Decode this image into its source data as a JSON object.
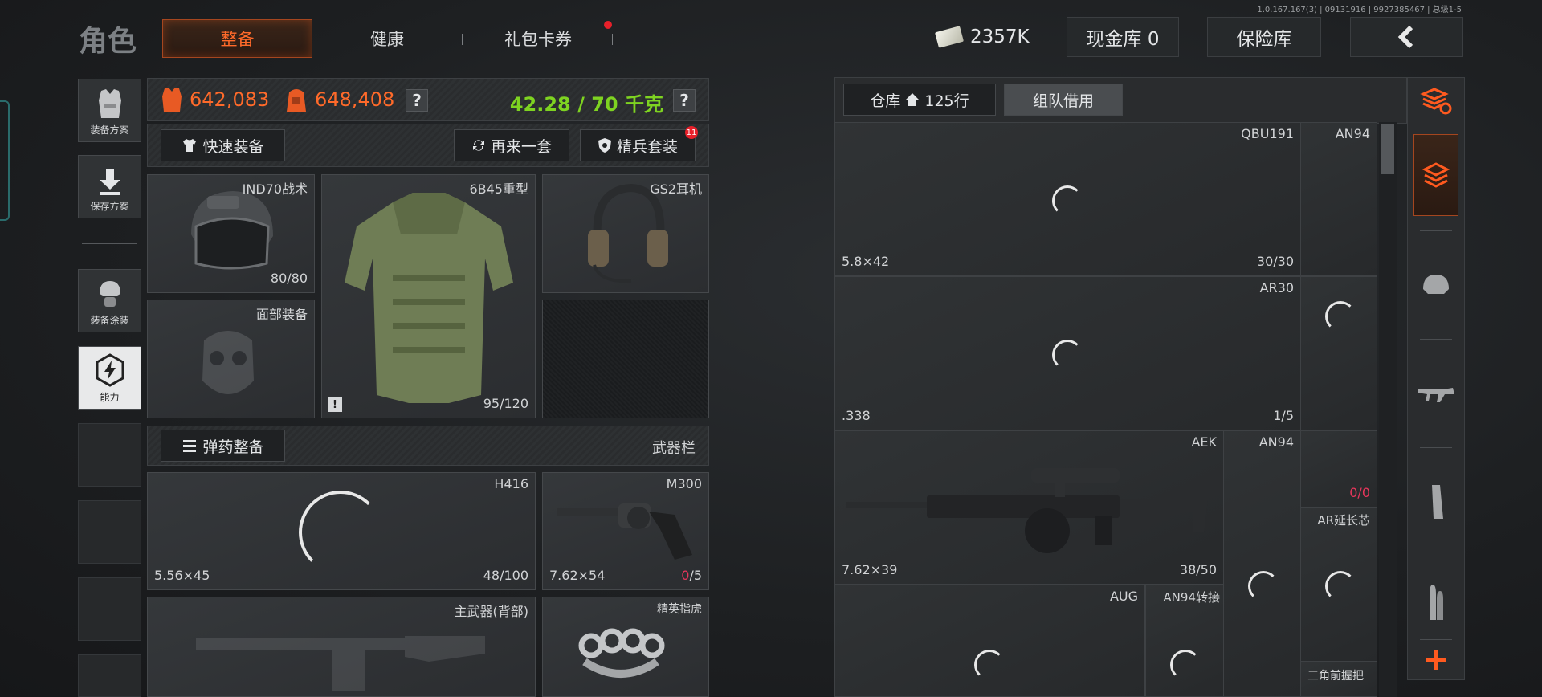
{
  "version": "1.0.167.167(3) | 09131916 | 9927385467 | 总级1-5",
  "title": "角色",
  "tabs": {
    "equip": "整备",
    "health": "健康",
    "gift": "礼包卡券"
  },
  "currency": {
    "cash": "2357K",
    "cash_vault": "现金库 0",
    "safe": "保险库"
  },
  "sidebar": {
    "plan": "装备方案",
    "save_plan": "保存方案",
    "paint": "装备涂装",
    "ability": "能力"
  },
  "stats": {
    "value1": "642,083",
    "value2": "648,408",
    "weight": "42.28 / 70 千克",
    "help": "?"
  },
  "actions": {
    "quick_equip": "快速装备",
    "again": "再来一套",
    "elite_set": "精兵套装",
    "elite_badge": "11",
    "ammo": "弹药整备",
    "weapon_bar": "武器栏"
  },
  "slots": {
    "helmet": {
      "name": "IND70战术",
      "durability": "80/80"
    },
    "armor": {
      "name": "6B45重型",
      "durability": "95/120"
    },
    "headset": {
      "name": "GS2耳机"
    },
    "face": {
      "name": "面部装备"
    },
    "primary": {
      "name": "H416",
      "caliber": "5.56×45",
      "ammo": "48/100"
    },
    "sidearm": {
      "name": "M300",
      "caliber": "7.62×54",
      "ammo_current": "0",
      "ammo_max": "/5"
    },
    "back_weapon": {
      "name": "主武器(背部)"
    },
    "melee": {
      "name": "精英指虎"
    }
  },
  "warehouse": {
    "tab_storage": "仓库",
    "rows": "125行",
    "tab_team": "组队借用",
    "items": [
      {
        "name": "QBU191",
        "caliber": "5.8×42",
        "ammo": "30/30"
      },
      {
        "name": "AN94",
        "caliber": "",
        "ammo": ""
      },
      {
        "name": "AR30",
        "caliber": ".338",
        "ammo": "1/5"
      },
      {
        "name": "AEK",
        "caliber": "7.62×39",
        "ammo": "38/50"
      },
      {
        "name": "AN94",
        "ammo_current": "0",
        "ammo_max": "/0"
      },
      {
        "name": "AR延长芯"
      },
      {
        "name": "AUG"
      },
      {
        "name": "AN94转接"
      },
      {
        "name": "三角前握把"
      }
    ]
  },
  "colors": {
    "accent": "#ff6a2a",
    "weight_ok": "#7ed321",
    "alert": "#e7365b"
  }
}
